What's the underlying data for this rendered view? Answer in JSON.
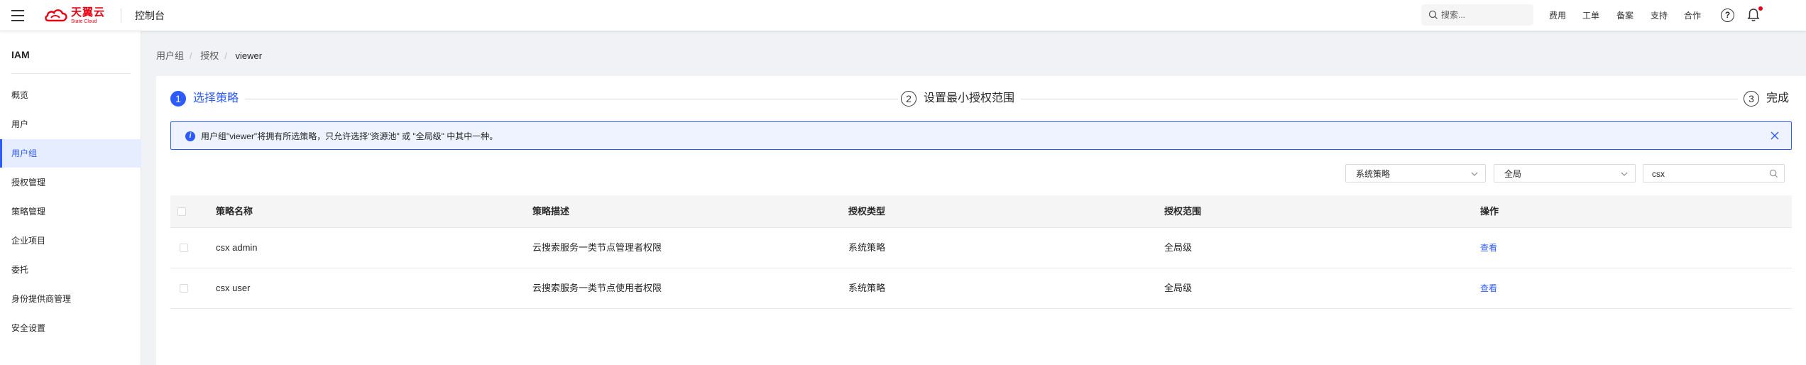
{
  "topbar": {
    "logo_text": "天翼云",
    "logo_sub": "State Cloud",
    "console": "控制台",
    "search_placeholder": "搜索...",
    "nav": [
      "费用",
      "工单",
      "备案",
      "支持",
      "合作"
    ]
  },
  "sidebar": {
    "title": "IAM",
    "items": [
      {
        "label": "概览"
      },
      {
        "label": "用户"
      },
      {
        "label": "用户组"
      },
      {
        "label": "授权管理"
      },
      {
        "label": "策略管理"
      },
      {
        "label": "企业项目"
      },
      {
        "label": "委托"
      },
      {
        "label": "身份提供商管理"
      },
      {
        "label": "安全设置"
      }
    ],
    "active_index": 2
  },
  "breadcrumb": [
    "用户组",
    "授权",
    "viewer"
  ],
  "steps": [
    {
      "num": "1",
      "label": "选择策略"
    },
    {
      "num": "2",
      "label": "设置最小授权范围"
    },
    {
      "num": "3",
      "label": "完成"
    }
  ],
  "alert": {
    "message": "用户组\"viewer\"将拥有所选策略，只允许选择\"资源池\" 或 \"全局级\" 中其中一种。"
  },
  "filters": {
    "policy_type": "系统策略",
    "scope": "全局",
    "search_value": "csx"
  },
  "table": {
    "columns": [
      "策略名称",
      "策略描述",
      "授权类型",
      "授权范围",
      "操作"
    ],
    "rows": [
      {
        "name": "csx admin",
        "desc": "云搜索服务一类节点管理者权限",
        "type": "系统策略",
        "scope": "全局级",
        "action": "查看"
      },
      {
        "name": "csx user",
        "desc": "云搜索服务一类节点使用者权限",
        "type": "系统策略",
        "scope": "全局级",
        "action": "查看"
      }
    ]
  },
  "colors": {
    "accent": "#2e5bff",
    "brand_red": "#e60012"
  }
}
